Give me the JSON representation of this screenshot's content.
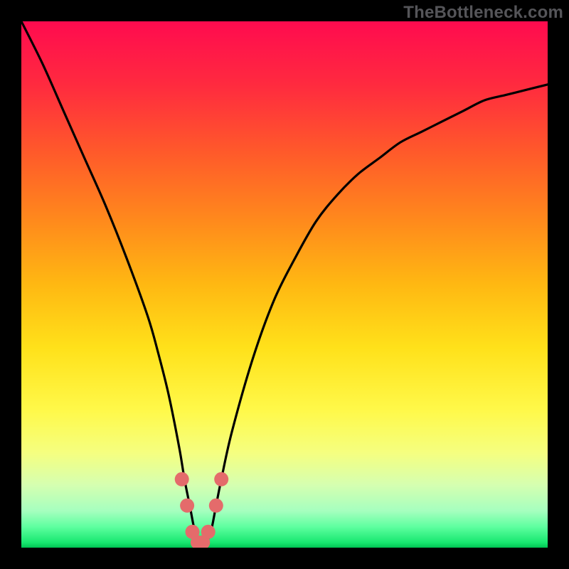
{
  "watermark": "TheBottleneck.com",
  "chart_data": {
    "type": "line",
    "title": "",
    "xlabel": "",
    "ylabel": "",
    "xlim": [
      0,
      100
    ],
    "ylim": [
      0,
      100
    ],
    "grid": false,
    "series": [
      {
        "name": "bottleneck-curve",
        "x": [
          0,
          4,
          8,
          12,
          16,
          20,
          24,
          26,
          28,
          30,
          31,
          32,
          33,
          34,
          35,
          36,
          37,
          38,
          40,
          44,
          48,
          52,
          56,
          60,
          64,
          68,
          72,
          76,
          80,
          84,
          88,
          92,
          96,
          100
        ],
        "values": [
          100,
          92,
          83,
          74,
          65,
          55,
          44,
          37,
          29,
          19,
          13,
          8,
          3,
          1,
          1,
          3,
          8,
          13,
          22,
          36,
          47,
          55,
          62,
          67,
          71,
          74,
          77,
          79,
          81,
          83,
          85,
          86,
          87,
          88
        ]
      }
    ],
    "background_gradient": {
      "stops": [
        {
          "pos": 0.0,
          "color": "#ff0b4f"
        },
        {
          "pos": 0.12,
          "color": "#ff2a3f"
        },
        {
          "pos": 0.25,
          "color": "#ff5a2a"
        },
        {
          "pos": 0.38,
          "color": "#ff8a1c"
        },
        {
          "pos": 0.5,
          "color": "#ffb812"
        },
        {
          "pos": 0.62,
          "color": "#ffe11a"
        },
        {
          "pos": 0.74,
          "color": "#fff94a"
        },
        {
          "pos": 0.82,
          "color": "#f5ff80"
        },
        {
          "pos": 0.88,
          "color": "#d6ffb0"
        },
        {
          "pos": 0.93,
          "color": "#a6ffbf"
        },
        {
          "pos": 0.96,
          "color": "#5fffa0"
        },
        {
          "pos": 0.99,
          "color": "#18e870"
        },
        {
          "pos": 1.0,
          "color": "#00c453"
        }
      ]
    },
    "markers": [
      {
        "x": 30.5,
        "y": 13,
        "color": "#e46b6b",
        "r": 10
      },
      {
        "x": 31.5,
        "y": 8,
        "color": "#e46b6b",
        "r": 10
      },
      {
        "x": 32.5,
        "y": 3,
        "color": "#e46b6b",
        "r": 10
      },
      {
        "x": 33.5,
        "y": 1,
        "color": "#e46b6b",
        "r": 10
      },
      {
        "x": 34.5,
        "y": 1,
        "color": "#e46b6b",
        "r": 10
      },
      {
        "x": 35.5,
        "y": 3,
        "color": "#e46b6b",
        "r": 10
      },
      {
        "x": 37.0,
        "y": 8,
        "color": "#e46b6b",
        "r": 10
      },
      {
        "x": 38.0,
        "y": 13,
        "color": "#e46b6b",
        "r": 10
      }
    ]
  }
}
